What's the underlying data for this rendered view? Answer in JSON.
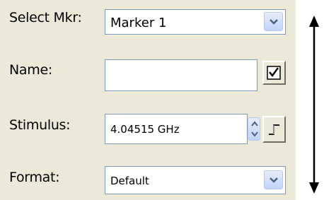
{
  "labels": {
    "select_mkr": "Select Mkr:",
    "name": "Name:",
    "stimulus": "Stimulus:",
    "format": "Format:"
  },
  "select_marker": {
    "value": "Marker 1",
    "icon": "chevron-down-icon"
  },
  "name_field": {
    "value": "",
    "action_icon": "checkmark-icon"
  },
  "stimulus": {
    "value": "4.04515 GHz",
    "spin_icon": "up-down-spinner-icon",
    "step_icon": "step-icon"
  },
  "format_select": {
    "value": "Default",
    "icon": "chevron-down-icon"
  },
  "annotation": {
    "icon": "double-headed-vertical-arrow-icon"
  }
}
